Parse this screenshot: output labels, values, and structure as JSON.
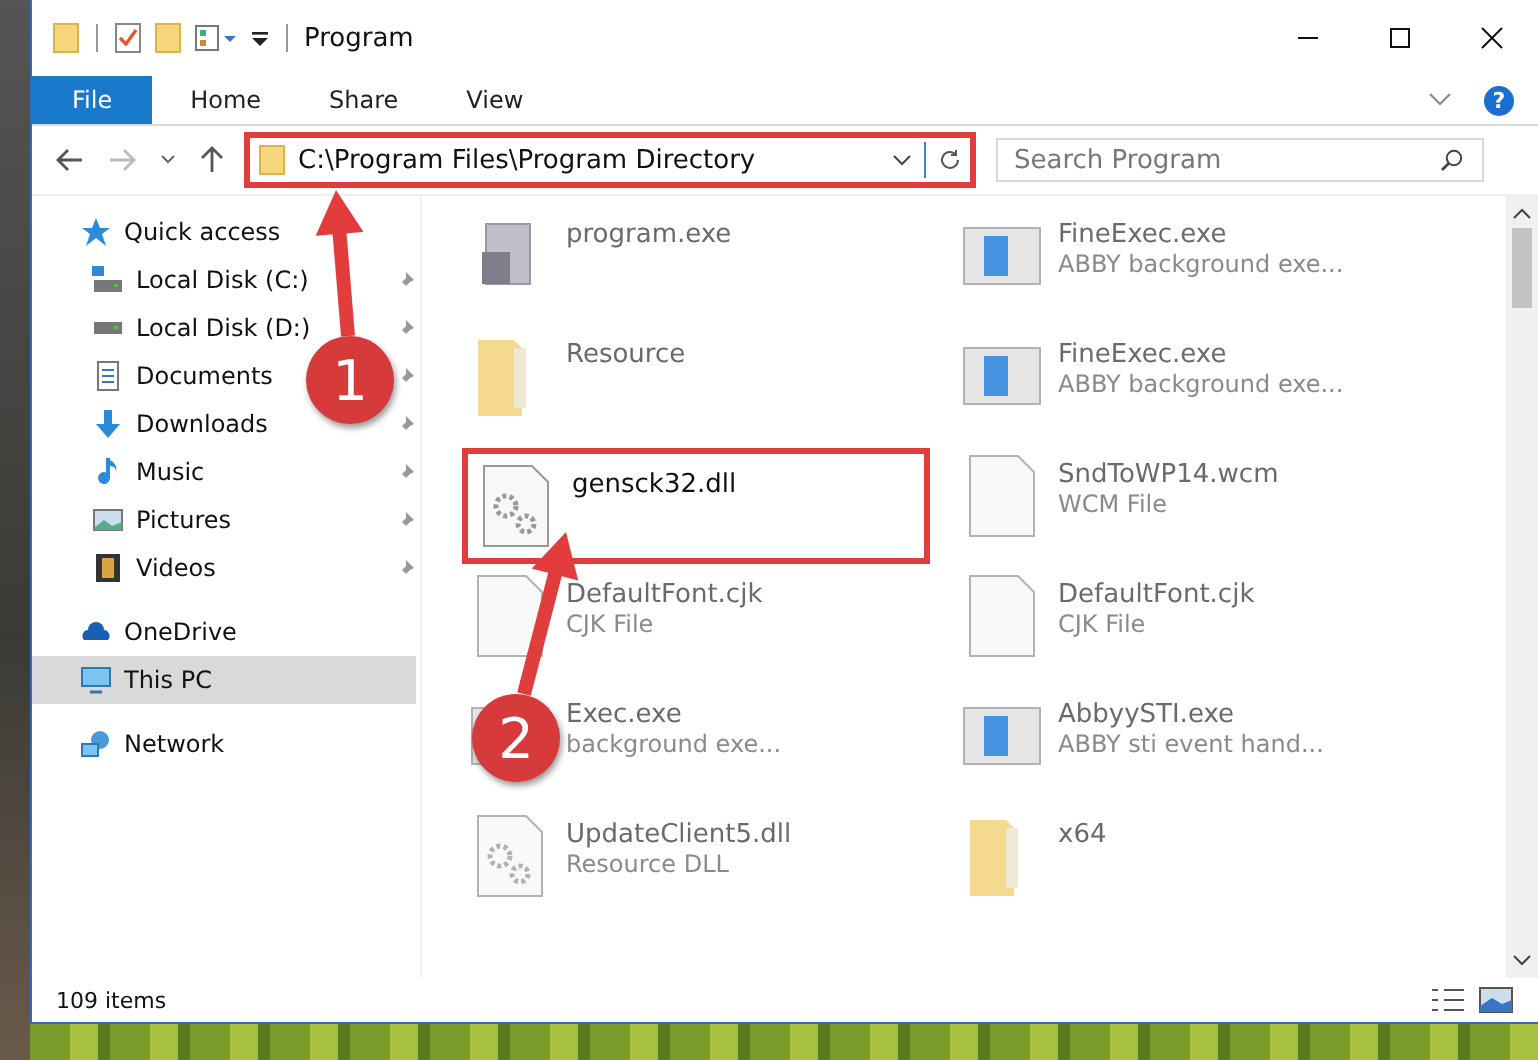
{
  "window": {
    "title": "Program"
  },
  "ribbon": {
    "tabs": [
      {
        "label": "File",
        "selected": true
      },
      {
        "label": "Home",
        "selected": false
      },
      {
        "label": "Share",
        "selected": false
      },
      {
        "label": "View",
        "selected": false
      }
    ],
    "help": "?"
  },
  "address": {
    "path": "C:\\Program Files\\Program Directory",
    "highlighted": true
  },
  "search": {
    "placeholder": "Search Program"
  },
  "nav": [
    {
      "label": "Quick access",
      "kind": "star",
      "selected": false,
      "children": [
        {
          "label": "Local Disk (C:)",
          "kind": "disk-c",
          "pinned": true,
          "selected": false
        },
        {
          "label": "Local Disk (D:)",
          "kind": "disk",
          "pinned": true,
          "selected": false
        },
        {
          "label": "Documents",
          "kind": "doc",
          "pinned": true,
          "selected": false
        },
        {
          "label": "Downloads",
          "kind": "download",
          "pinned": true,
          "selected": false
        },
        {
          "label": "Music",
          "kind": "music",
          "pinned": true,
          "selected": false
        },
        {
          "label": "Pictures",
          "kind": "picture",
          "pinned": true,
          "selected": false
        },
        {
          "label": "Videos",
          "kind": "video",
          "pinned": true,
          "selected": false
        }
      ]
    },
    {
      "label": "OneDrive",
      "kind": "cloud",
      "selected": false
    },
    {
      "label": "This PC",
      "kind": "pc",
      "selected": true
    },
    {
      "label": "Network",
      "kind": "network",
      "selected": false
    }
  ],
  "files": [
    {
      "name": "program.exe",
      "kind": "app",
      "blurred": true,
      "highlighted": false
    },
    {
      "name": "FineExec.exe",
      "subtitle": "ABBY background exe...",
      "kind": "window",
      "blurred": true,
      "highlighted": false
    },
    {
      "name": "Resource",
      "kind": "folder",
      "blurred": true,
      "highlighted": false
    },
    {
      "name": "FineExec.exe",
      "subtitle": "ABBY background exe...",
      "kind": "window",
      "blurred": true,
      "highlighted": false
    },
    {
      "name": "gensck32.dll",
      "kind": "dll",
      "blurred": false,
      "highlighted": true
    },
    {
      "name": "SndToWP14.wcm",
      "subtitle": "WCM File",
      "kind": "file",
      "blurred": true,
      "highlighted": false
    },
    {
      "name": "DefaultFont.cjk",
      "subtitle": "CJK File",
      "kind": "file",
      "blurred": true,
      "highlighted": false
    },
    {
      "name": "DefaultFont.cjk",
      "subtitle": "CJK File",
      "kind": "file",
      "blurred": true,
      "highlighted": false
    },
    {
      "name": "Exec.exe",
      "subtitle": "background exe...",
      "kind": "window",
      "blurred": true,
      "highlighted": false
    },
    {
      "name": "AbbyySTI.exe",
      "subtitle": "ABBY sti event hand...",
      "kind": "window",
      "blurred": true,
      "highlighted": false
    },
    {
      "name": "UpdateClient5.dll",
      "subtitle": "Resource DLL",
      "kind": "dll",
      "blurred": true,
      "highlighted": false
    },
    {
      "name": "x64",
      "kind": "folder",
      "blurred": true,
      "highlighted": false
    }
  ],
  "status_bar": {
    "count": "109 items"
  },
  "callouts": [
    {
      "number": "1"
    },
    {
      "number": "2"
    }
  ]
}
